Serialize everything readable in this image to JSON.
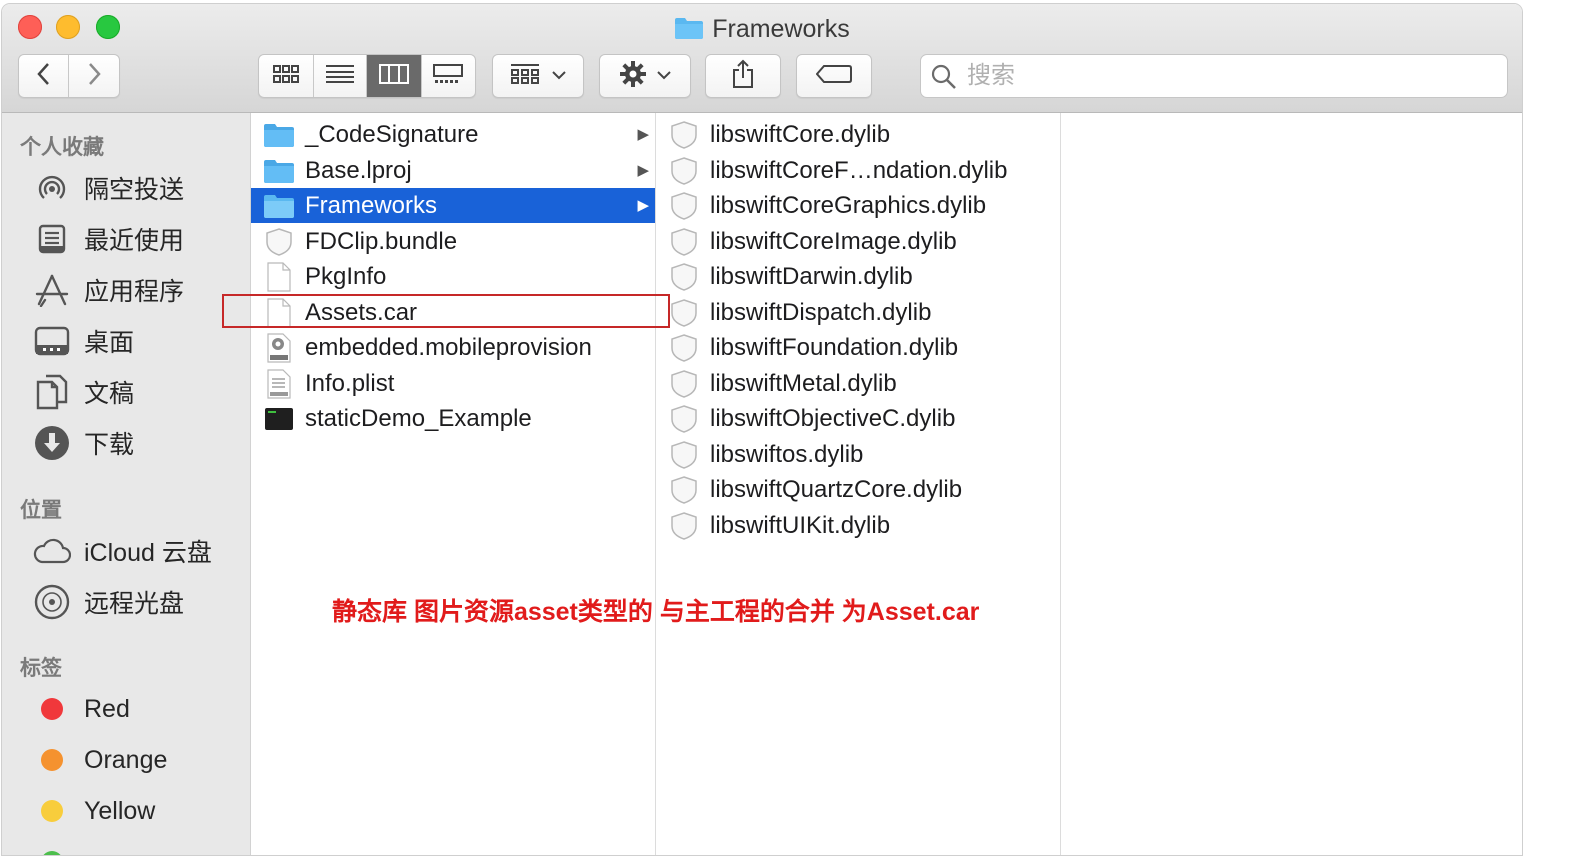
{
  "window": {
    "title": "Frameworks"
  },
  "toolbar": {
    "back_icon": "chevron-left-icon",
    "forward_icon": "chevron-right-icon",
    "view_modes": [
      "icon-view",
      "list-view",
      "column-view",
      "gallery-view"
    ],
    "active_view": "column-view",
    "group_icon": "group-grid-icon",
    "action_icon": "gear-icon",
    "share_icon": "share-icon",
    "tag_icon": "tag-icon",
    "search_placeholder": "搜索"
  },
  "sidebar": {
    "favorites_header": "个人收藏",
    "favorites": [
      {
        "label": "隔空投送",
        "icon": "airdrop-icon"
      },
      {
        "label": "最近使用",
        "icon": "recents-icon"
      },
      {
        "label": "应用程序",
        "icon": "applications-icon"
      },
      {
        "label": "桌面",
        "icon": "desktop-icon"
      },
      {
        "label": "文稿",
        "icon": "documents-icon"
      },
      {
        "label": "下载",
        "icon": "downloads-icon"
      }
    ],
    "locations_header": "位置",
    "locations": [
      {
        "label": "iCloud 云盘",
        "icon": "cloud-icon"
      },
      {
        "label": "远程光盘",
        "icon": "disc-icon"
      }
    ],
    "tags_header": "标签",
    "tags": [
      {
        "label": "Red",
        "color": "#f0383b"
      },
      {
        "label": "Orange",
        "color": "#f5922f"
      },
      {
        "label": "Yellow",
        "color": "#f8cd3c"
      },
      {
        "label": "",
        "color": "#4cbe4c"
      }
    ]
  },
  "column1": {
    "items": [
      {
        "name": "_CodeSignature",
        "icon": "folder-icon",
        "has_children": true
      },
      {
        "name": "Base.lproj",
        "icon": "folder-icon",
        "has_children": true
      },
      {
        "name": "Frameworks",
        "icon": "folder-icon",
        "has_children": true,
        "selected": true
      },
      {
        "name": "FDClip.bundle",
        "icon": "bundle-icon"
      },
      {
        "name": "PkgInfo",
        "icon": "document-icon"
      },
      {
        "name": "Assets.car",
        "icon": "document-icon",
        "highlighted": true
      },
      {
        "name": "embedded.mobileprovision",
        "icon": "provision-icon"
      },
      {
        "name": "Info.plist",
        "icon": "plist-icon"
      },
      {
        "name": "staticDemo_Example",
        "icon": "executable-icon"
      }
    ]
  },
  "column2": {
    "items": [
      {
        "name": "libswiftCore.dylib"
      },
      {
        "name": "libswiftCoreF…ndation.dylib"
      },
      {
        "name": "libswiftCoreGraphics.dylib"
      },
      {
        "name": "libswiftCoreImage.dylib"
      },
      {
        "name": "libswiftDarwin.dylib"
      },
      {
        "name": "libswiftDispatch.dylib"
      },
      {
        "name": "libswiftFoundation.dylib"
      },
      {
        "name": "libswiftMetal.dylib"
      },
      {
        "name": "libswiftObjectiveC.dylib"
      },
      {
        "name": "libswiftos.dylib"
      },
      {
        "name": "libswiftQuartzCore.dylib"
      },
      {
        "name": "libswiftUIKit.dylib"
      }
    ],
    "item_icon": "dylib-icon"
  },
  "annotation": {
    "text": "静态库 图片资源asset类型的 与主工程的合并 为Asset.car",
    "color": "#e11b1b"
  }
}
